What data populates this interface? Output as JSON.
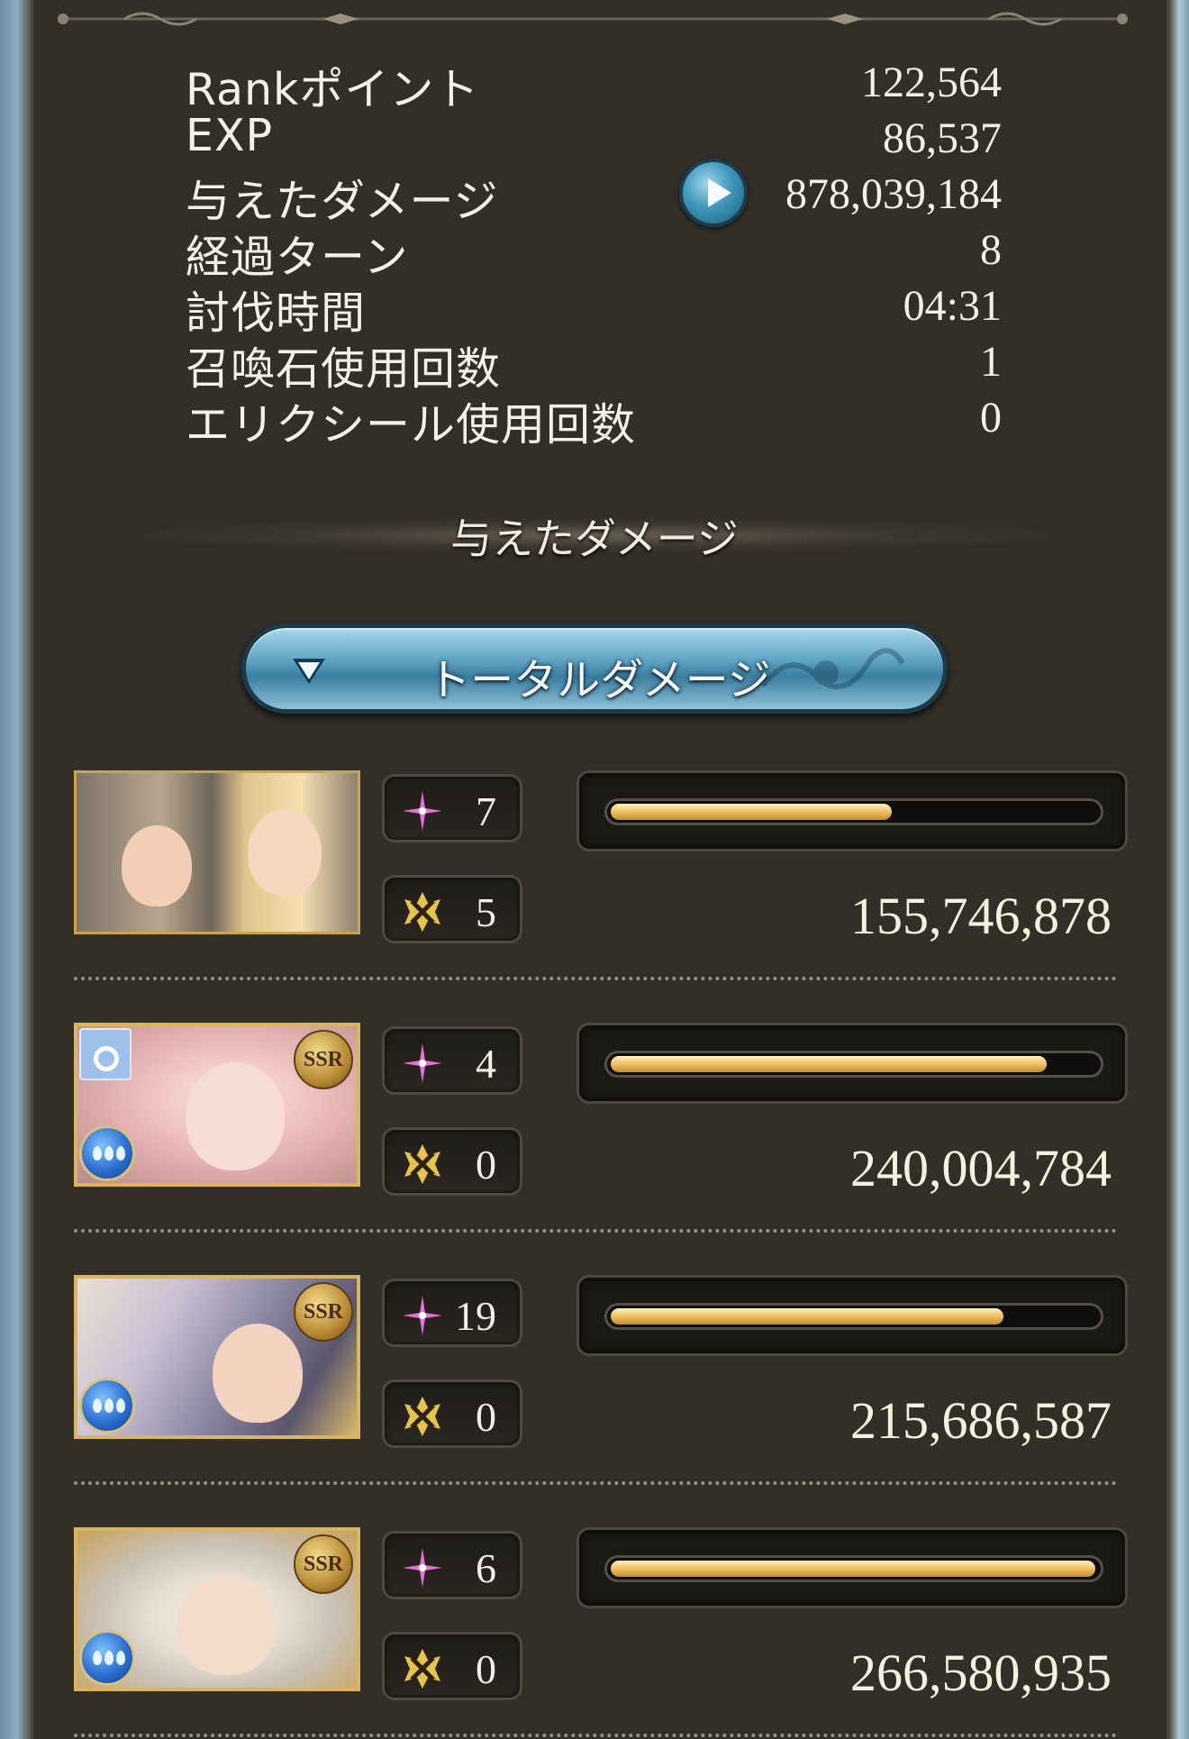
{
  "stats": [
    {
      "label": "Rankポイント",
      "value": "122,564"
    },
    {
      "label": "EXP",
      "value": "86,537"
    },
    {
      "label": "与えたダメージ",
      "value": "878,039,184"
    },
    {
      "label": "経過ターン",
      "value": "8"
    },
    {
      "label": "討伐時間",
      "value": "04:31"
    },
    {
      "label": "召喚石使用回数",
      "value": "1"
    },
    {
      "label": "エリクシール使用回数",
      "value": "0"
    }
  ],
  "section_title": "与えたダメージ",
  "damage_filter": {
    "selected": "トータルダメージ"
  },
  "members": [
    {
      "ca_count": "7",
      "skill_count": "5",
      "damage": "155,746,878",
      "bar_fraction": 0.58,
      "rarity": "",
      "element": ""
    },
    {
      "ca_count": "4",
      "skill_count": "0",
      "damage": "240,004,784",
      "bar_fraction": 0.9,
      "rarity": "SSR",
      "element": "water"
    },
    {
      "ca_count": "19",
      "skill_count": "0",
      "damage": "215,686,587",
      "bar_fraction": 0.81,
      "rarity": "SSR",
      "element": "water"
    },
    {
      "ca_count": "6",
      "skill_count": "0",
      "damage": "266,580,935",
      "bar_fraction": 1.0,
      "rarity": "SSR",
      "element": "water"
    }
  ],
  "colors": {
    "panel": "#322f28",
    "accent_blue": "#5fa4c3",
    "bar_gold": "#f3c56a",
    "ca_icon": "#e86fd8"
  }
}
